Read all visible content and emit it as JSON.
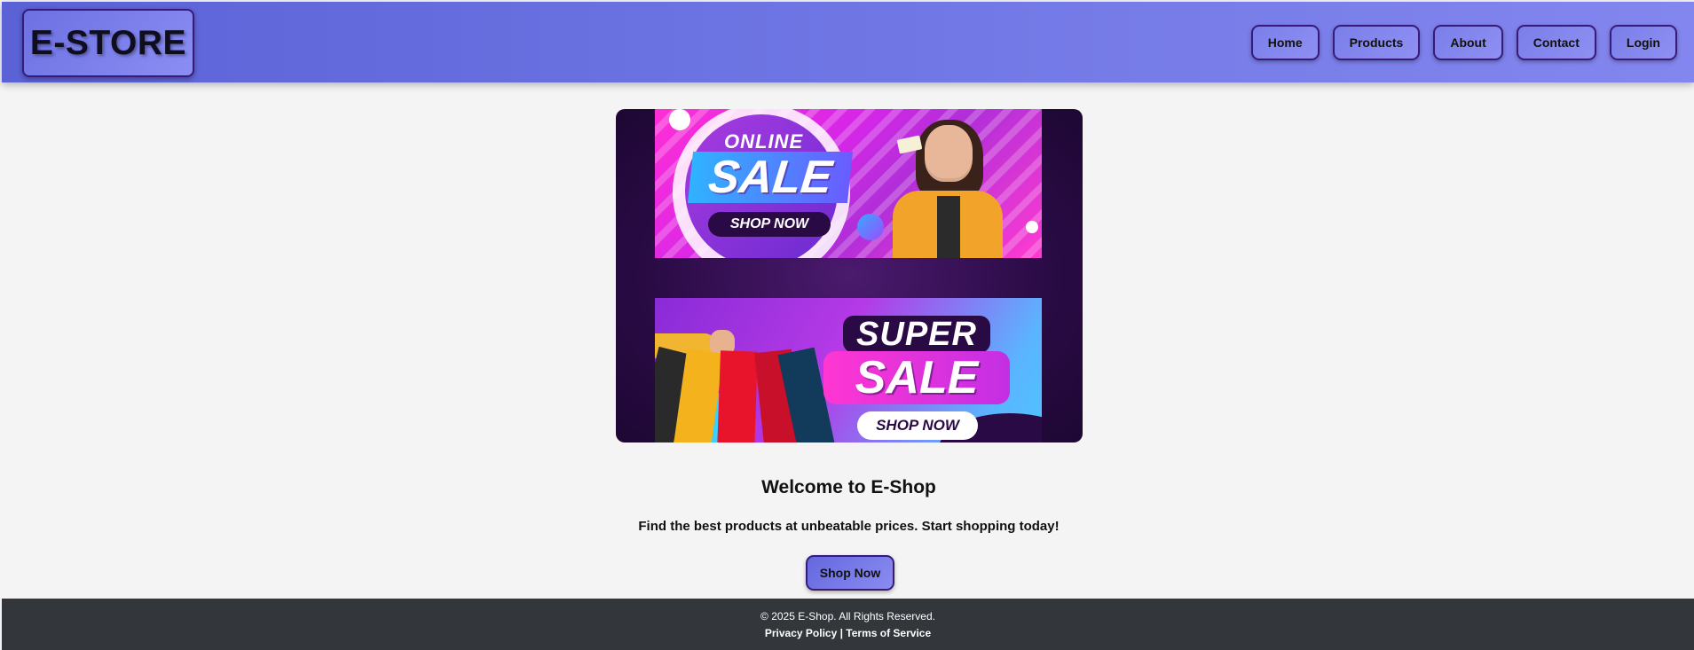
{
  "header": {
    "logo_text": "E-STORE",
    "nav": [
      {
        "label": "Home"
      },
      {
        "label": "Products"
      },
      {
        "label": "About"
      },
      {
        "label": "Contact"
      },
      {
        "label": "Login"
      }
    ]
  },
  "banner": {
    "promo1": {
      "line1": "ONLINE",
      "line2": "SALE",
      "cta": "SHOP NOW"
    },
    "promo2": {
      "line1": "SUPER",
      "line2": "SALE",
      "cta": "SHOP NOW"
    }
  },
  "main": {
    "title": "Welcome to E-Shop",
    "subtitle": "Find the best products at unbeatable prices. Start shopping today!",
    "cta": "Shop Now"
  },
  "footer": {
    "copyright": "© 2025 E-Shop. All Rights Reserved.",
    "privacy": "Privacy Policy",
    "separator": "|",
    "terms": "Terms of Service"
  },
  "colors": {
    "header_start": "#5a62d6",
    "header_end": "#8486ef",
    "button_border": "#3a1a78",
    "footer_bg": "#33373b",
    "page_bg": "#f4f4f4"
  }
}
